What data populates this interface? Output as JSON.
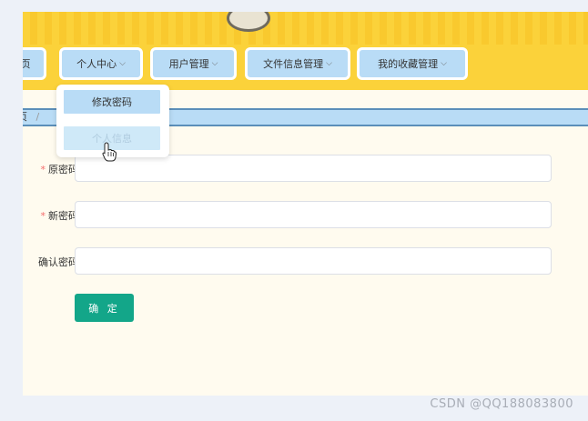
{
  "nav": {
    "items": [
      {
        "label": "页",
        "chevron": ""
      },
      {
        "label": "个人中心",
        "chevron": "⌵"
      },
      {
        "label": "用户管理",
        "chevron": "⌵"
      },
      {
        "label": "文件信息管理",
        "chevron": "⌵"
      },
      {
        "label": "我的收藏管理",
        "chevron": "⌵"
      }
    ]
  },
  "dropdown": {
    "items": [
      {
        "label": "修改密码"
      },
      {
        "label": "个人信息"
      }
    ]
  },
  "breadcrumb": {
    "home": "页",
    "separator": "/"
  },
  "form": {
    "required_mark": "*",
    "fields": [
      {
        "label": "原密码",
        "value": ""
      },
      {
        "label": "新密码",
        "value": ""
      },
      {
        "label": "确认密码",
        "value": ""
      }
    ],
    "submit_label": "确 定"
  },
  "watermark": "CSDN @QQ188083800",
  "colors": {
    "nav_yellow": "#fbd23a",
    "nav_item_blue": "#b9dcf6",
    "button_green": "#13a689",
    "required_red": "#f56c6c"
  }
}
